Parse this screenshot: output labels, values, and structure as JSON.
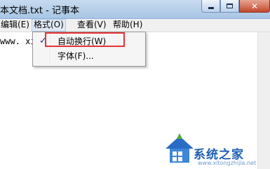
{
  "window": {
    "title": "本文档.txt - 记事本",
    "buttons": {
      "minimize": "minimize-icon",
      "maximize": "maximize-icon",
      "close": "close-icon"
    }
  },
  "menubar": {
    "items": [
      {
        "label": "编辑(E)",
        "active": false
      },
      {
        "label": "格式(O)",
        "active": true
      },
      {
        "label": "查看(V)",
        "active": false
      },
      {
        "label": "帮助(H)",
        "active": false
      }
    ]
  },
  "format_menu": {
    "items": [
      {
        "label": "自动换行(W)",
        "checked": true
      },
      {
        "label": "字体(F)..."
      }
    ],
    "check_glyph": "✓"
  },
  "editor": {
    "text": "www. xi"
  },
  "watermark": {
    "brand": "系统之家",
    "url": "www.xitongzhijia.net"
  },
  "colors": {
    "highlight_border": "#e53238",
    "titlebar": "#b9d1ea",
    "close_button": "#c3462b",
    "watermark_text": "#1f5fb6"
  }
}
